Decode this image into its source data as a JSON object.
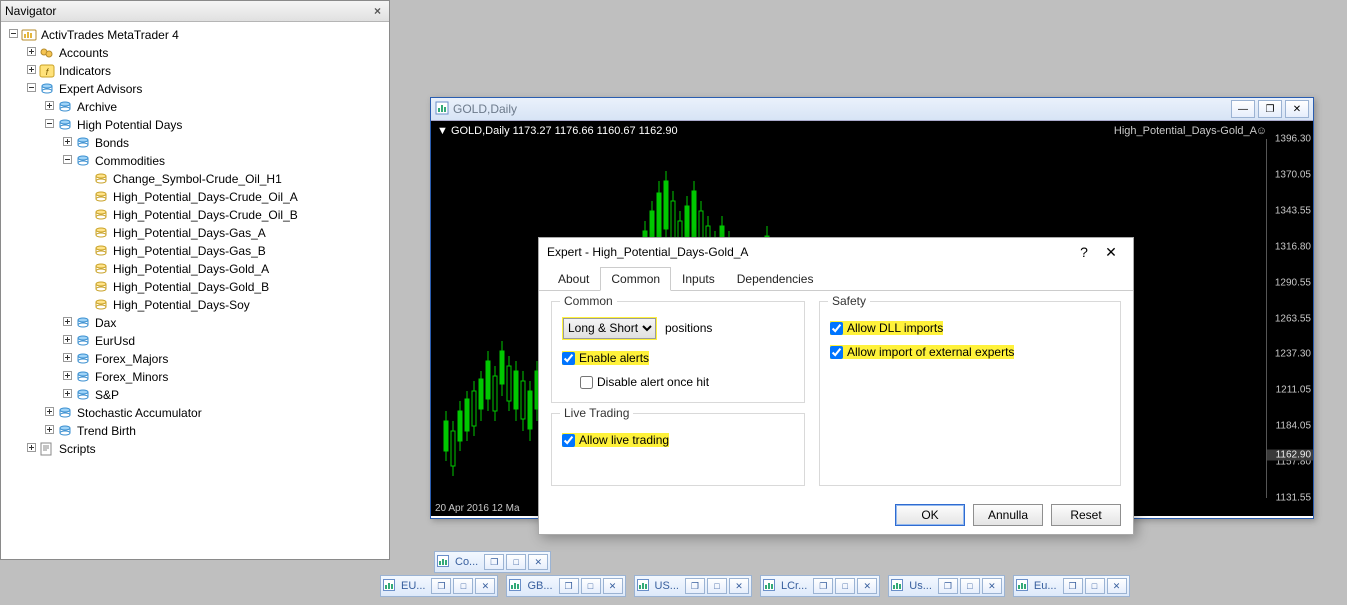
{
  "navigator": {
    "title": "Navigator",
    "tree": [
      {
        "depth": 0,
        "tw": "-",
        "icon": "mt4",
        "label": "ActivTrades MetaTrader 4"
      },
      {
        "depth": 1,
        "tw": "+",
        "icon": "accounts",
        "label": "Accounts"
      },
      {
        "depth": 1,
        "tw": "+",
        "icon": "indicators",
        "label": "Indicators"
      },
      {
        "depth": 1,
        "tw": "-",
        "icon": "folder",
        "label": "Expert Advisors"
      },
      {
        "depth": 2,
        "tw": "+",
        "icon": "folder",
        "label": "Archive"
      },
      {
        "depth": 2,
        "tw": "-",
        "icon": "folder",
        "label": "High Potential Days"
      },
      {
        "depth": 3,
        "tw": "+",
        "icon": "folder",
        "label": "Bonds"
      },
      {
        "depth": 3,
        "tw": "-",
        "icon": "folder",
        "label": "Commodities"
      },
      {
        "depth": 4,
        "tw": "",
        "icon": "ea",
        "label": "Change_Symbol-Crude_Oil_H1"
      },
      {
        "depth": 4,
        "tw": "",
        "icon": "ea",
        "label": "High_Potential_Days-Crude_Oil_A"
      },
      {
        "depth": 4,
        "tw": "",
        "icon": "ea",
        "label": "High_Potential_Days-Crude_Oil_B"
      },
      {
        "depth": 4,
        "tw": "",
        "icon": "ea",
        "label": "High_Potential_Days-Gas_A"
      },
      {
        "depth": 4,
        "tw": "",
        "icon": "ea",
        "label": "High_Potential_Days-Gas_B"
      },
      {
        "depth": 4,
        "tw": "",
        "icon": "ea",
        "label": "High_Potential_Days-Gold_A"
      },
      {
        "depth": 4,
        "tw": "",
        "icon": "ea",
        "label": "High_Potential_Days-Gold_B"
      },
      {
        "depth": 4,
        "tw": "",
        "icon": "ea",
        "label": "High_Potential_Days-Soy"
      },
      {
        "depth": 3,
        "tw": "+",
        "icon": "folder",
        "label": "Dax"
      },
      {
        "depth": 3,
        "tw": "+",
        "icon": "folder",
        "label": "EurUsd"
      },
      {
        "depth": 3,
        "tw": "+",
        "icon": "folder",
        "label": "Forex_Majors"
      },
      {
        "depth": 3,
        "tw": "+",
        "icon": "folder",
        "label": "Forex_Minors"
      },
      {
        "depth": 3,
        "tw": "+",
        "icon": "folder",
        "label": "S&P"
      },
      {
        "depth": 2,
        "tw": "+",
        "icon": "folder",
        "label": "Stochastic Accumulator"
      },
      {
        "depth": 2,
        "tw": "+",
        "icon": "folder",
        "label": "Trend Birth"
      },
      {
        "depth": 1,
        "tw": "+",
        "icon": "scripts",
        "label": "Scripts"
      }
    ]
  },
  "chart": {
    "title": "GOLD,Daily",
    "header": "▼ GOLD,Daily  1173.27 1176.66 1160.67 1162.90",
    "ea_label": "High_Potential_Days-Gold_A",
    "smile": "☺",
    "yticks": [
      "1396.30",
      "1370.05",
      "1343.55",
      "1316.80",
      "1290.55",
      "1263.55",
      "1237.30",
      "1211.05",
      "1184.05",
      "1157.80",
      "1131.55"
    ],
    "current": "1162.90",
    "xlabels": "20 Apr 2016   12 Ma"
  },
  "dialog": {
    "title": "Expert - High_Potential_Days-Gold_A",
    "tabs": {
      "about": "About",
      "common": "Common",
      "inputs": "Inputs",
      "deps": "Dependencies"
    },
    "common": {
      "legend": "Common",
      "positions_sel": "Long & Short",
      "positions_lbl": "positions",
      "enable_alerts": "Enable alerts",
      "disable_once": "Disable alert once hit"
    },
    "live": {
      "legend": "Live Trading",
      "allow": "Allow live trading"
    },
    "safety": {
      "legend": "Safety",
      "dll": "Allow DLL imports",
      "ext": "Allow import of external experts"
    },
    "buttons": {
      "ok": "OK",
      "cancel": "Annulla",
      "reset": "Reset"
    }
  },
  "taskbar": {
    "row1": [
      {
        "nm": "Co..."
      }
    ],
    "row2": [
      {
        "nm": "EU..."
      },
      {
        "nm": "GB..."
      },
      {
        "nm": "US..."
      },
      {
        "nm": "LCr..."
      },
      {
        "nm": "Us..."
      },
      {
        "nm": "Eu..."
      }
    ]
  }
}
